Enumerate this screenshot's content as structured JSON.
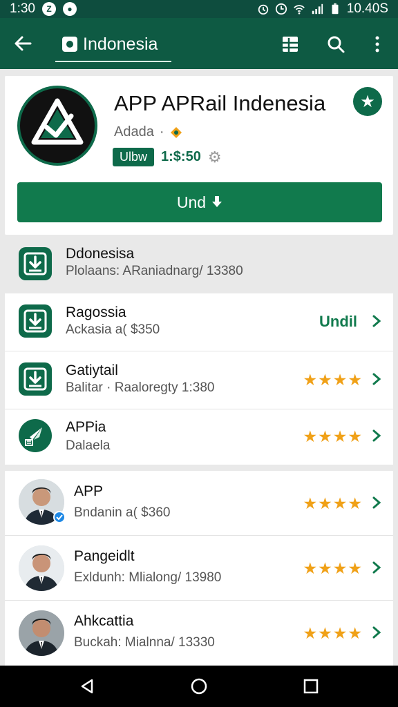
{
  "status": {
    "time": "1:30",
    "clock": "10.40S"
  },
  "appbar": {
    "title": "Indonesia"
  },
  "hero": {
    "title": "APP APRail Indenesia",
    "developer": "Adada",
    "chip": "Ulbw",
    "meta_value": "1:$:50",
    "install_label": "Und",
    "colors": {
      "primary": "#117a4d",
      "dark": "#0e4d3e"
    }
  },
  "section": {
    "title": "Ddonesisa",
    "subtitle": "Plolaans: ARaniadnarg/ 13380"
  },
  "list1": [
    {
      "title": "Ragossia",
      "subtitle": "Ackasia a( $350",
      "action": "Undil",
      "icon": "download-icon"
    },
    {
      "title": "Gatiytail",
      "subtitle": "Balitar · Raaloregty 1:380",
      "rating": 4,
      "icon": "download-icon"
    },
    {
      "title": "APPia",
      "subtitle": "Dalaela",
      "rating": 4,
      "icon": "rocket-icon"
    }
  ],
  "list2": [
    {
      "title": "APP",
      "subtitle": "Bndanin a( $360",
      "rating": 4
    },
    {
      "title": "Pangeidlt",
      "subtitle": "Exldunh: Mlialong/ 13980",
      "rating": 4
    },
    {
      "title": "Ahkcattia",
      "subtitle": "Buckah: Mialnna/ 13330",
      "rating": 4
    }
  ],
  "star_glyphs": "★★★★"
}
